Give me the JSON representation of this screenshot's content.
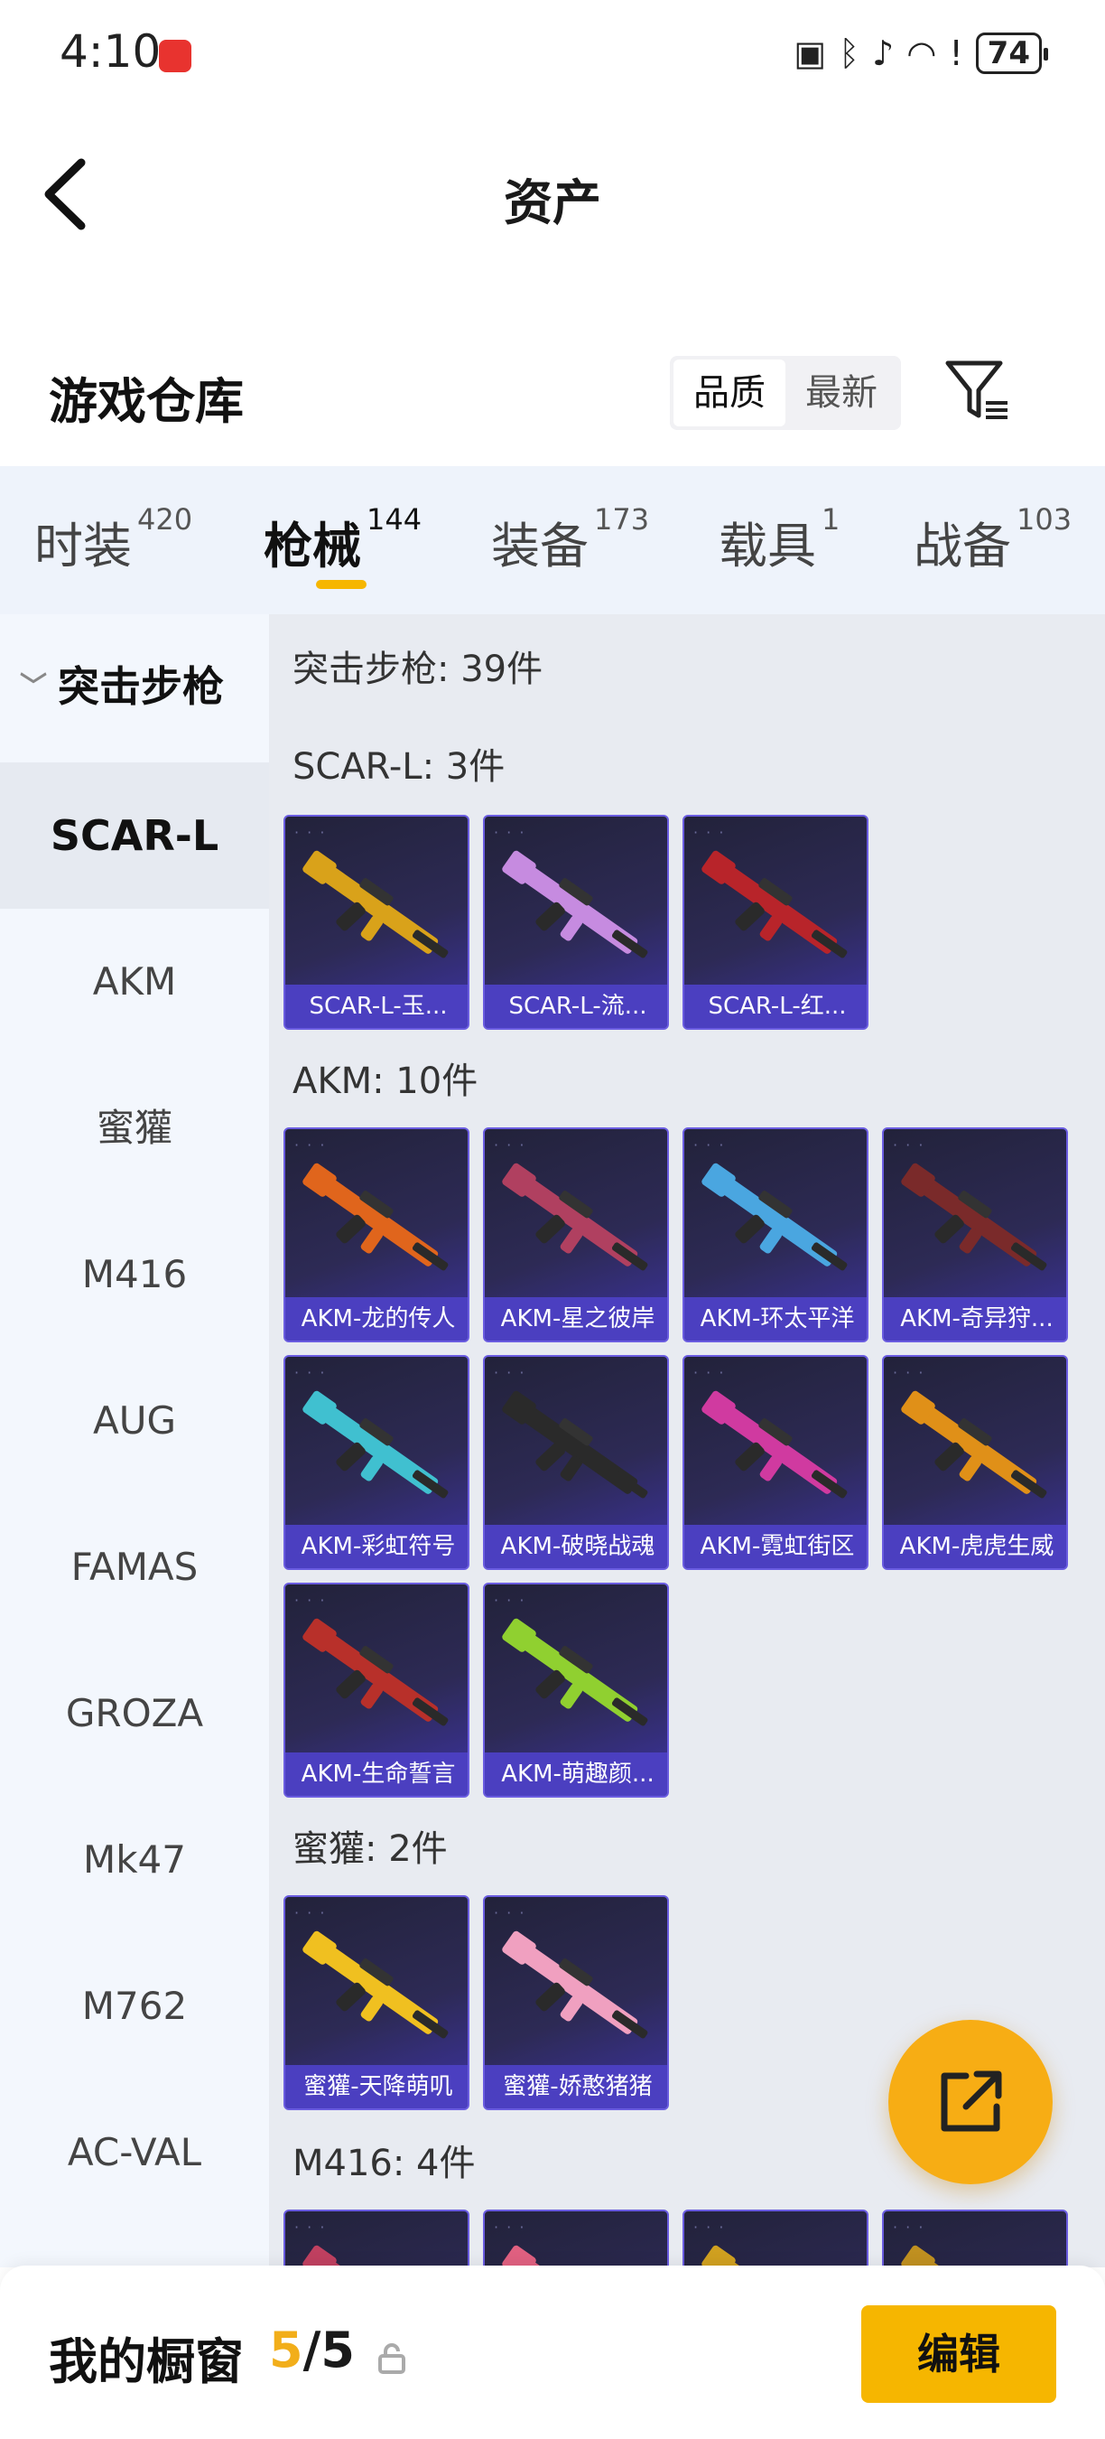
{
  "status_bar": {
    "time": "4:10",
    "battery": "74"
  },
  "header": {
    "title": "资产"
  },
  "section": {
    "title": "游戏仓库",
    "sort_options": [
      "品质",
      "最新"
    ],
    "sort_selected": "品质"
  },
  "tabs": [
    {
      "label": "时装",
      "count": "420"
    },
    {
      "label": "枪械",
      "count": "144",
      "active": true
    },
    {
      "label": "装备",
      "count": "173"
    },
    {
      "label": "载具",
      "count": "1"
    },
    {
      "label": "战备",
      "count": "103"
    }
  ],
  "sidebar": {
    "group": "突击步枪",
    "items": [
      "SCAR-L",
      "AKM",
      "蜜獾",
      "M416",
      "AUG",
      "FAMAS",
      "GROZA",
      "Mk47",
      "M762",
      "AC-VAL"
    ],
    "active": "SCAR-L"
  },
  "content": {
    "total_heading": "突击步枪: 39件",
    "groups": [
      {
        "heading": "SCAR-L: 3件",
        "items": [
          "SCAR-L-玉...",
          "SCAR-L-流...",
          "SCAR-L-红..."
        ]
      },
      {
        "heading": "AKM: 10件",
        "items": [
          "AKM-龙的传人",
          "AKM-星之彼岸",
          "AKM-环太平洋",
          "AKM-奇异狩...",
          "AKM-彩虹符号",
          "AKM-破晓战魂",
          "AKM-霓虹街区",
          "AKM-虎虎生威",
          "AKM-生命誓言",
          "AKM-萌趣颜..."
        ]
      },
      {
        "heading": "蜜獾: 2件",
        "items": [
          "蜜獾-天降萌叽",
          "蜜獾-娇憨猪猪"
        ]
      },
      {
        "heading": "M416: 4件",
        "items": [
          "",
          "",
          "",
          ""
        ]
      }
    ]
  },
  "bottom_bar": {
    "title": "我的橱窗",
    "count_current": "5",
    "count_sep": "/",
    "count_total": "5",
    "edit_label": "编辑"
  },
  "colors": {
    "accent": "#f6b600",
    "card_label": "#4b3fc0",
    "tab_bg": "#eef3fb"
  },
  "icons": [
    "back-arrow-icon",
    "filter-icon",
    "share-icon",
    "lock-icon"
  ]
}
